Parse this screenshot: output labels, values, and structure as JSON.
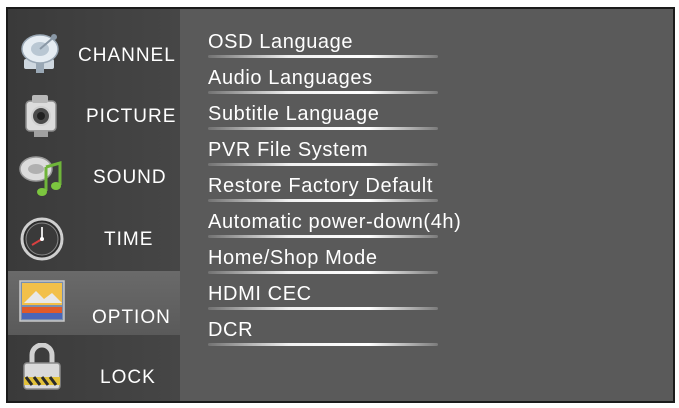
{
  "sidebar": {
    "items": [
      {
        "label": "CHANNEL",
        "icon": "satellite-dish-icon",
        "selected": false
      },
      {
        "label": "PICTURE",
        "icon": "camera-icon",
        "selected": false
      },
      {
        "label": "SOUND",
        "icon": "music-note-icon",
        "selected": false
      },
      {
        "label": "TIME",
        "icon": "clock-icon",
        "selected": false
      },
      {
        "label": "OPTION",
        "icon": "image-icon",
        "selected": true
      },
      {
        "label": "LOCK",
        "icon": "padlock-icon",
        "selected": false
      }
    ]
  },
  "main": {
    "options": [
      {
        "label": "OSD Language"
      },
      {
        "label": "Audio Languages"
      },
      {
        "label": "Subtitle Language"
      },
      {
        "label": "PVR File System"
      },
      {
        "label": "Restore Factory Default"
      },
      {
        "label": "Automatic power-down(4h)"
      },
      {
        "label": "Home/Shop Mode"
      },
      {
        "label": "HDMI CEC"
      },
      {
        "label": "DCR"
      }
    ]
  },
  "colors": {
    "panel": "#5a5a5a",
    "sidebar": "#404040",
    "selected": "#666666",
    "text": "#ffffff"
  }
}
